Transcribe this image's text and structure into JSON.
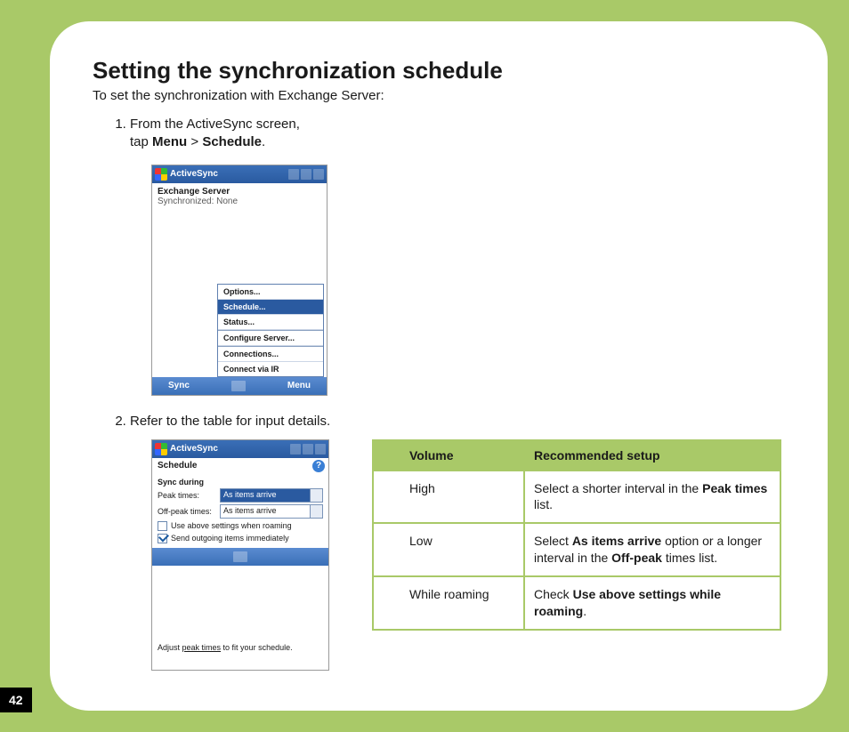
{
  "page_number": "42",
  "heading": "Setting the synchronization schedule",
  "intro": "To set the synchronization with Exchange Server:",
  "steps": {
    "s1_prefix": "From the ActiveSync screen,",
    "s1_line2a": "tap ",
    "s1_menu": "Menu",
    "s1_gt": " > ",
    "s1_schedule": "Schedule",
    "s1_period": ".",
    "s2": "Refer to the table for input details."
  },
  "shot1": {
    "title": "ActiveSync",
    "body_line1": "Exchange Server",
    "body_line2": "Synchronized: None",
    "menu": {
      "options": "Options...",
      "schedule": "Schedule...",
      "status": "Status...",
      "configure": "Configure Server...",
      "connections": "Connections...",
      "connect_ir": "Connect via IR"
    },
    "soft_left": "Sync",
    "soft_right": "Menu"
  },
  "shot2": {
    "title": "ActiveSync",
    "subheader": "Schedule",
    "help": "?",
    "group": "Sync during",
    "peak_label": "Peak times:",
    "peak_value": "As items arrive",
    "offpeak_label": "Off-peak times:",
    "offpeak_value": "As items arrive",
    "chk1": "Use above settings when roaming",
    "chk2": "Send outgoing items immediately",
    "footnote_a": "Adjust ",
    "footnote_link": "peak times",
    "footnote_b": " to fit your schedule."
  },
  "table": {
    "hdr_volume": "Volume",
    "hdr_setup": "Recommended setup",
    "r1_vol": "High",
    "r1_a": "Select a shorter interval in the ",
    "r1_b": "Peak times",
    "r1_c": " list.",
    "r2_vol": "Low",
    "r2_a": "Select ",
    "r2_b": "As items arrive",
    "r2_c": " option or a longer interval in the ",
    "r2_d": "Off-peak",
    "r2_e": " times list.",
    "r3_vol": "While roaming",
    "r3_a": "Check ",
    "r3_b": "Use above settings while roaming",
    "r3_c": "."
  }
}
